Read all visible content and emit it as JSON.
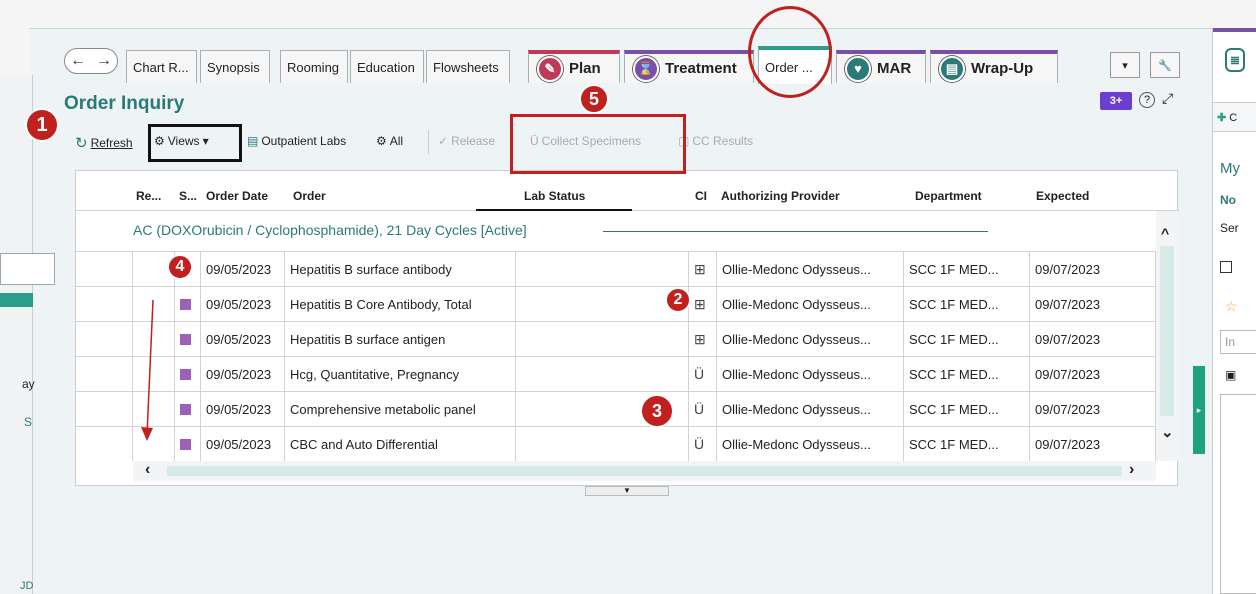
{
  "tabs": {
    "nav": {
      "back": "←",
      "forward": "→"
    },
    "items": [
      {
        "label": "Chart R..."
      },
      {
        "label": "Synopsis"
      },
      {
        "label": "Rooming"
      },
      {
        "label": "Education"
      },
      {
        "label": "Flowsheets"
      }
    ],
    "big": [
      {
        "label": "Plan",
        "color": "#c0395b"
      },
      {
        "label": "Treatment",
        "color": "#7a4fa8"
      },
      {
        "label": "Order ...",
        "color": "#2b9e8a"
      },
      {
        "label": "MAR",
        "color": "#7a4fa8"
      },
      {
        "label": "Wrap-Up",
        "color": "#7a4fa8"
      }
    ],
    "more": "▾",
    "tools": "🔧"
  },
  "activity": {
    "title": "Order Inquiry",
    "header_tools": {
      "badge": "3+",
      "help": "?",
      "expand": "⤢"
    }
  },
  "toolbar": {
    "refresh": "Refresh",
    "views": "Views",
    "outpatient_labs": "Outpatient Labs",
    "all": "All",
    "release": "Release",
    "collect_specimens": "Collect Specimens",
    "cc_results": "CC Results"
  },
  "grid": {
    "columns": [
      "Re...",
      "S...",
      "Order Date",
      "Order",
      "Lab Status",
      "CI",
      "Authorizing Provider",
      "Department",
      "Expected"
    ],
    "group": "AC (DOXOrubicin / Cyclophosphamide), 21 Day Cycles [Active]",
    "rows": [
      {
        "date": "09/05/2023",
        "order": "Hepatitis B surface antibody",
        "ci": "⊞",
        "provider": "Ollie-Medonc Odysseus...",
        "dept": "SCC 1F MED...",
        "expected": "09/07/2023"
      },
      {
        "date": "09/05/2023",
        "order": "Hepatitis B Core Antibody, Total",
        "ci": "⊞",
        "provider": "Ollie-Medonc Odysseus...",
        "dept": "SCC 1F MED...",
        "expected": "09/07/2023"
      },
      {
        "date": "09/05/2023",
        "order": "Hepatitis B surface antigen",
        "ci": "⊞",
        "provider": "Ollie-Medonc Odysseus...",
        "dept": "SCC 1F MED...",
        "expected": "09/07/2023"
      },
      {
        "date": "09/05/2023",
        "order": "Hcg, Quantitative, Pregnancy",
        "ci": "Ü",
        "provider": "Ollie-Medonc Odysseus...",
        "dept": "SCC 1F MED...",
        "expected": "09/07/2023"
      },
      {
        "date": "09/05/2023",
        "order": "Comprehensive metabolic panel",
        "ci": "Ü",
        "provider": "Ollie-Medonc Odysseus...",
        "dept": "SCC 1F MED...",
        "expected": "09/07/2023"
      },
      {
        "date": "09/05/2023",
        "order": "CBC and Auto Differential",
        "ci": "Ü",
        "provider": "Ollie-Medonc Odysseus...",
        "dept": "SCC 1F MED...",
        "expected": "09/07/2023"
      }
    ],
    "scroll": {
      "left": "‹",
      "right": "›",
      "up": "^",
      "down": "⌄"
    }
  },
  "annotations": {
    "a1": "1",
    "a2": "2",
    "a3": "3",
    "a4": "4",
    "a5": "5"
  },
  "left_pane": {
    "frag1": "ay",
    "frag2": "S",
    "frag3": "JD"
  },
  "right_pane": {
    "add": "C",
    "my": "My",
    "no": "No",
    "ser": "Ser",
    "ins": "In"
  },
  "colors": {
    "accent": "#2b7a78",
    "annotation": "#c0201e",
    "order_square": "#9c62b8"
  }
}
